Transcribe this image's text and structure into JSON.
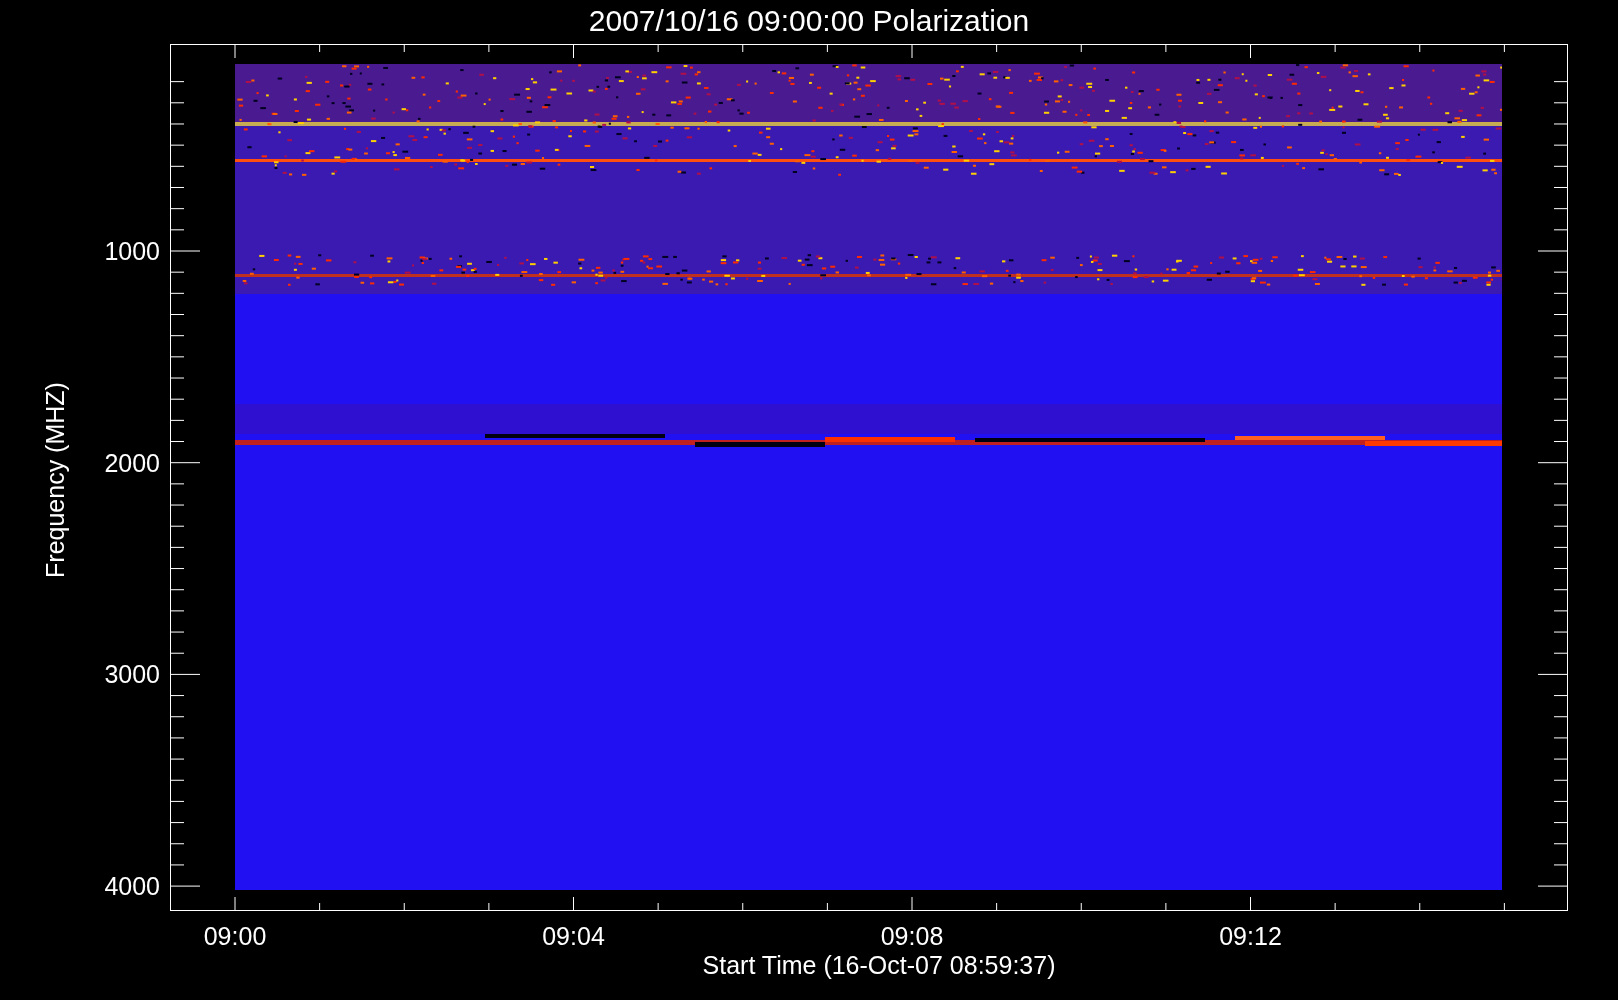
{
  "title": "2007/10/16 09:00:00 Polarization",
  "y_axis": {
    "label": "Frequency (MHZ)",
    "ticks": [
      "1000",
      "2000",
      "3000",
      "4000"
    ]
  },
  "x_axis": {
    "label": "Start Time (16-Oct-07 08:59:37)",
    "ticks": [
      "09:00",
      "09:04",
      "09:08",
      "09:12"
    ]
  }
}
